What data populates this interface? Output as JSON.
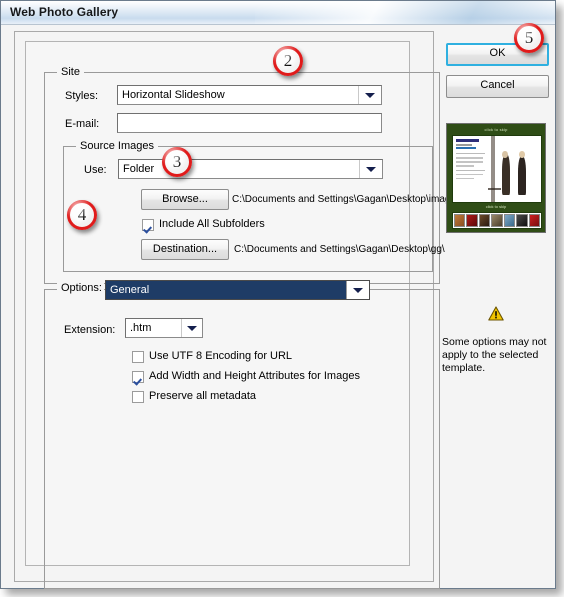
{
  "window": {
    "title": "Web Photo Gallery"
  },
  "site": {
    "group_label": "Site",
    "styles_label": "Styles:",
    "styles_value": "Horizontal Slideshow",
    "email_label": "E-mail:",
    "email_value": ""
  },
  "source_images": {
    "group_label": "Source Images",
    "use_label": "Use:",
    "use_value": "Folder",
    "browse_button": "Browse...",
    "browse_path": "C:\\Documents and Settings\\Gagan\\Desktop\\images\\",
    "include_subfolders_label": "Include All Subfolders",
    "include_subfolders_checked": true,
    "destination_button": "Destination...",
    "destination_path": "C:\\Documents and Settings\\Gagan\\Desktop\\gg\\"
  },
  "options": {
    "group_label": "Options:",
    "selected_option": "General",
    "extension_label": "Extension:",
    "extension_value": ".htm",
    "checkboxes": [
      {
        "label": "Use UTF 8 Encoding for URL",
        "checked": false
      },
      {
        "label": "Add Width and Height Attributes for Images",
        "checked": true
      },
      {
        "label": "Preserve all metadata",
        "checked": false
      }
    ]
  },
  "actions": {
    "ok_label": "OK",
    "cancel_label": "Cancel"
  },
  "preview": {
    "top_label": "click to skip",
    "bottom_label": "click to skip",
    "warning_icon": "warning-triangle-icon",
    "warning_text": "Some options may not apply to the selected template."
  },
  "callouts": [
    {
      "number": "2"
    },
    {
      "number": "3"
    },
    {
      "number": "4"
    },
    {
      "number": "5"
    }
  ],
  "colors": {
    "accent": "#1e3c66",
    "badge_ring": "#e01b1b",
    "focus_ring": "#2fb0e0",
    "preview_bg": "#2f4d16",
    "warning": "#f2c500"
  }
}
